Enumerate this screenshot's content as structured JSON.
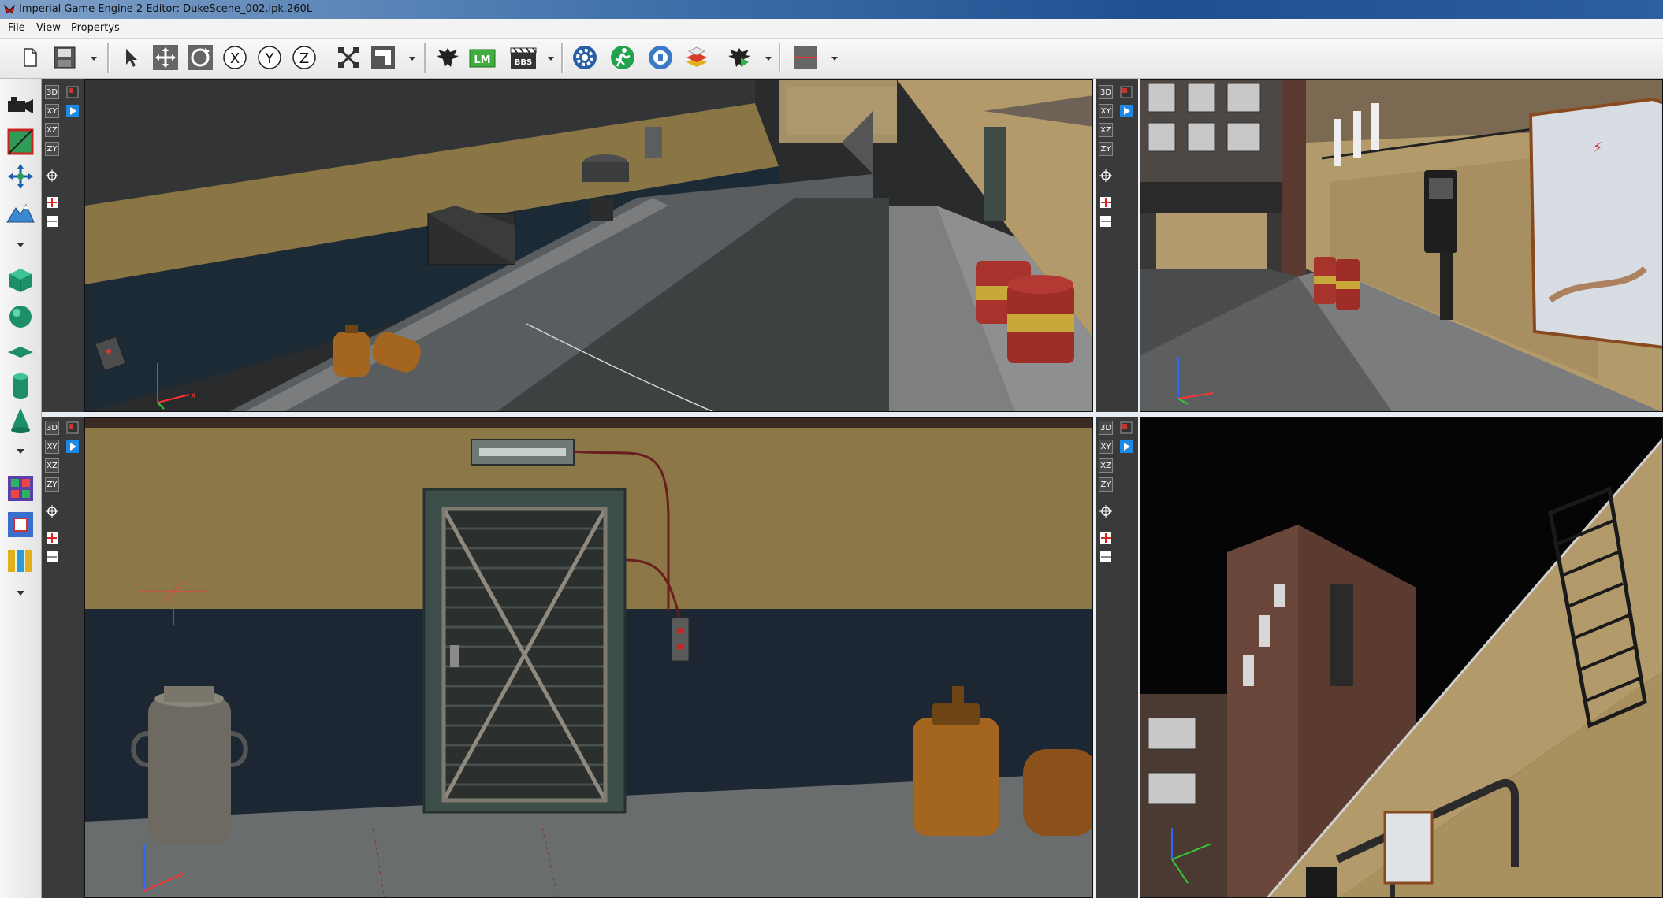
{
  "window": {
    "title": "Imperial Game Engine 2 Editor: DukeScene_002.ipk.260L"
  },
  "menu": {
    "file": "File",
    "view": "View",
    "propertys": "Propertys"
  },
  "toolbar": {
    "buttons": [
      {
        "name": "new-document-icon"
      },
      {
        "name": "save-icon"
      },
      {
        "name": "select-arrow-icon"
      },
      {
        "name": "move-icon"
      },
      {
        "name": "rotate-icon"
      },
      {
        "name": "axis-x-icon"
      },
      {
        "name": "axis-y-icon"
      },
      {
        "name": "axis-z-icon"
      },
      {
        "name": "scale-icon"
      },
      {
        "name": "snap-icon"
      },
      {
        "name": "eagle-icon"
      },
      {
        "name": "lightmap-icon"
      },
      {
        "name": "bbs-clapper-icon"
      },
      {
        "name": "settings-gear-icon"
      },
      {
        "name": "run-icon"
      },
      {
        "name": "info-icon"
      },
      {
        "name": "layers-icon"
      },
      {
        "name": "eagle-play-icon"
      },
      {
        "name": "viewport-layout-icon"
      }
    ],
    "lm_text": "LM",
    "bbs_text": "BBS",
    "x_text": "X",
    "y_text": "Y",
    "z_text": "Z"
  },
  "viewport_controls": {
    "v3d": "3D",
    "xy": "XY",
    "xz": "XZ",
    "zy": "ZY"
  },
  "axis_gizmo": {
    "x": "x"
  },
  "colors": {
    "accent": "#1e88e5",
    "titlebar": "#2c5fa0",
    "wall_yellow": "#a08a4e",
    "wall_blue": "#1e2a36"
  }
}
